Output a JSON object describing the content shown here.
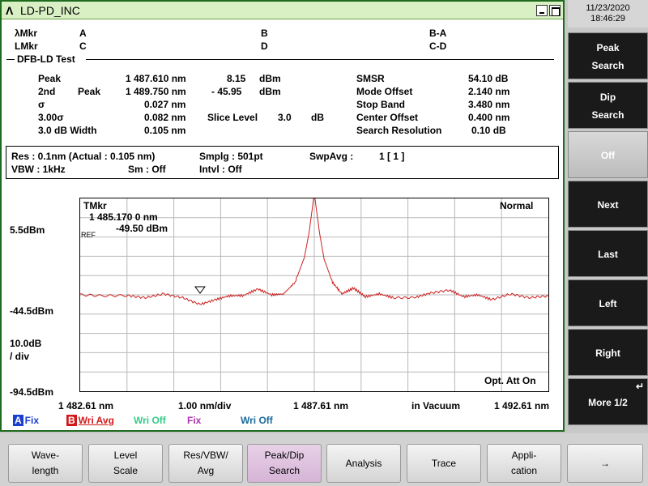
{
  "window": {
    "logo": "Λ",
    "title": "LD-PD_INC"
  },
  "markers": {
    "lambda_label": "λMkr",
    "l_label": "LMkr",
    "a": "A",
    "b": "B",
    "ba": "B-A",
    "c": "C",
    "d": "D",
    "cd": "C-D"
  },
  "section_title": "DFB-LD Test",
  "results": {
    "peak_label": "Peak",
    "peak_wl": "1 487.610 nm",
    "peak_level": "8.15",
    "peak_unit": "dBm",
    "second_label": "2nd",
    "second_peak_label": "Peak",
    "second_wl": "1 489.750 nm",
    "second_level": "-  45.95",
    "second_unit": "dBm",
    "sigma_label": "σ",
    "sigma_value": "0.027 nm",
    "three_sigma_label": "3.00σ",
    "three_sigma_value": "0.082 nm",
    "slice_label": "Slice Level",
    "slice_value": "3.0",
    "slice_unit": "dB",
    "width_label": "3.0   dB Width",
    "width_value": "0.105 nm",
    "smsr_label": "SMSR",
    "smsr_value": "54.10 dB",
    "mode_offset_label": "Mode Offset",
    "mode_offset_value": "2.140 nm",
    "stop_band_label": "Stop Band",
    "stop_band_value": "3.480 nm",
    "center_offset_label": "Center Offset",
    "center_offset_value": "0.400 nm",
    "search_res_label": "Search Resolution",
    "search_res_value": "0.10  dB"
  },
  "settings": {
    "res": "Res :  0.1nm  (Actual :  0.105 nm)",
    "smplg": "Smplg :      501pt",
    "swpavg_label": "SwpAvg :",
    "swpavg_value": "1 [       1  ]",
    "vbw": "VBW :      1kHz",
    "sm": "Sm :    Off",
    "intvl": "Intvl :    Off"
  },
  "graph": {
    "tmkr_label": "TMkr",
    "tmkr_wl": "1 485.170 0   nm",
    "tmkr_level": "-49.50   dBm",
    "ref_label": "REF",
    "mode": "Normal",
    "opt_att": "Opt. Att On",
    "y_top": "5.5dBm",
    "y_ref": "-44.5dBm",
    "y_scale": "10.0dB",
    "y_div": "/ div",
    "y_bottom": "-94.5dBm",
    "x_start": "1 482.61 nm",
    "x_span": "1.00 nm/div",
    "x_center": "1 487.61 nm",
    "x_medium": "in Vacuum",
    "x_stop": "1 492.61 nm"
  },
  "traces": [
    {
      "letter": "A",
      "name": "Fix",
      "letter_color": "#1a3fd0",
      "name_color": "#1a3fd0"
    },
    {
      "letter": "B",
      "name": "Wri Avg",
      "letter_color": "#d01a1a",
      "name_color": "#d01a1a"
    },
    {
      "letter": "",
      "name": "Wri Off",
      "name_color": "#33cc88"
    },
    {
      "letter": "",
      "name": "Fix",
      "name_color": "#aa33aa"
    },
    {
      "letter": "",
      "name": "Wri Off",
      "name_color": "#1a6a9a"
    }
  ],
  "clock": {
    "date": "11/23/2020",
    "time": "18:46:29"
  },
  "softkeys": [
    {
      "l1": "Peak",
      "l2": "Search"
    },
    {
      "l1": "Dip",
      "l2": "Search"
    },
    {
      "l1": "Off",
      "l2": ""
    },
    {
      "l1": "Next",
      "l2": ""
    },
    {
      "l1": "Last",
      "l2": ""
    },
    {
      "l1": "Left",
      "l2": ""
    },
    {
      "l1": "Right",
      "l2": ""
    },
    {
      "l1": "More 1/2",
      "l2": ""
    }
  ],
  "function_keys": [
    {
      "l1": "Wave-",
      "l2": "length"
    },
    {
      "l1": "Level",
      "l2": "Scale"
    },
    {
      "l1": "Res/VBW/",
      "l2": "Avg"
    },
    {
      "l1": "Peak/Dip",
      "l2": "Search"
    },
    {
      "l1": "Analysis",
      "l2": ""
    },
    {
      "l1": "Trace",
      "l2": ""
    },
    {
      "l1": "Appli-",
      "l2": "cation"
    },
    {
      "l1": "→",
      "l2": ""
    }
  ],
  "chart_data": {
    "type": "line",
    "x_range": [
      1482.61,
      1492.61
    ],
    "y_range": [
      -94.5,
      5.5
    ],
    "grid": true,
    "series": [
      {
        "name": "B",
        "color": "#cc2222",
        "x": [
          1482.61,
          1483.1,
          1483.6,
          1484.0,
          1484.4,
          1484.8,
          1485.17,
          1485.5,
          1485.8,
          1486.1,
          1486.4,
          1486.7,
          1486.95,
          1487.2,
          1487.4,
          1487.5,
          1487.61,
          1487.72,
          1487.82,
          1488.0,
          1488.2,
          1488.45,
          1488.7,
          1489.0,
          1489.3,
          1489.75,
          1490.1,
          1490.5,
          1490.8,
          1491.1,
          1491.4,
          1491.8,
          1492.2,
          1492.61
        ],
        "y": [
          -44.5,
          -45.0,
          -44.8,
          -46.0,
          -44.0,
          -46.0,
          -49.5,
          -47.0,
          -45.0,
          -44.8,
          -41.5,
          -44.5,
          -44.0,
          -38.0,
          -25.0,
          -12.0,
          8.15,
          -12.0,
          -26.0,
          -38.0,
          -44.0,
          -41.0,
          -45.5,
          -44.0,
          -46.0,
          -45.95,
          -43.5,
          -42.0,
          -45.5,
          -44.5,
          -47.0,
          -44.0,
          -46.0,
          -45.0
        ]
      }
    ]
  }
}
